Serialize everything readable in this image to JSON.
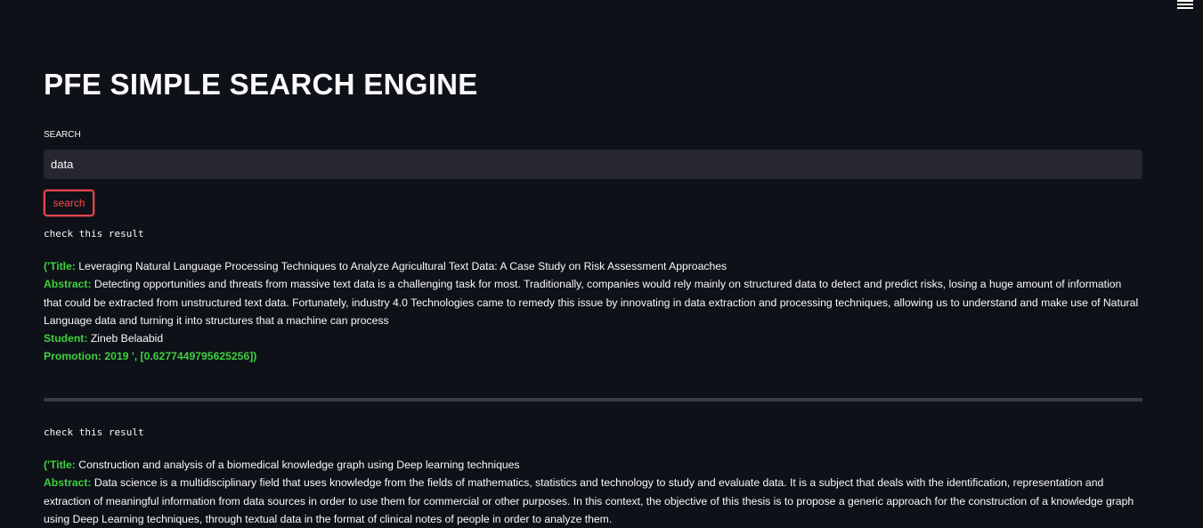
{
  "header": {
    "menu_icon": "hamburger-menu-icon"
  },
  "page": {
    "title": "PFE SIMPLE SEARCH ENGINE"
  },
  "search": {
    "label": "SEARCH",
    "value": "data",
    "button_label": "search"
  },
  "colors": {
    "background": "#0e1117",
    "input_background": "#262730",
    "accent_red": "#ff4b4b",
    "label_green": "#3fd13f",
    "divider": "#3a3b42"
  },
  "results": [
    {
      "check_text": "check this result",
      "open_prefix": "('",
      "title_label": "Title:",
      "title": "Leveraging Natural Language Processing Techniques to Analyze Agricultural Text Data: A Case Study on Risk Assessment Approaches",
      "abstract_label": "Abstract:",
      "abstract": "Detecting opportunities and threats from massive text data is a challenging task for most. Traditionally, companies would rely mainly on structured data to detect and predict risks, losing a huge amount of information that could be extracted from unstructured text data. Fortunately, industry 4.0 Technologies came to remedy this issue by innovating in data extraction and processing techniques, allowing us to understand and make use of Natural Language data and turning it into structures that a machine can process",
      "student_label": "Student:",
      "student": "Zineb Belaabid",
      "promotion_label": "Promotion:",
      "promotion": "2019 ', [0.6277449795625256])"
    },
    {
      "check_text": "check this result",
      "open_prefix": "('",
      "title_label": "Title:",
      "title": "Construction and analysis of a biomedical knowledge graph using Deep learning techniques",
      "abstract_label": "Abstract:",
      "abstract": "Data science is a multidisciplinary field that uses knowledge from the fields of mathematics, statistics and technology to study and evaluate data. It is a subject that deals with the identification, representation and extraction of meaningful information from data sources in order to use them for commercial or other purposes. In this context, the objective of this thesis is to propose a generic approach for the construction of a knowledge graph using Deep Learning techniques, through textual data in the format of clinical notes of people in order to analyze them."
    }
  ]
}
